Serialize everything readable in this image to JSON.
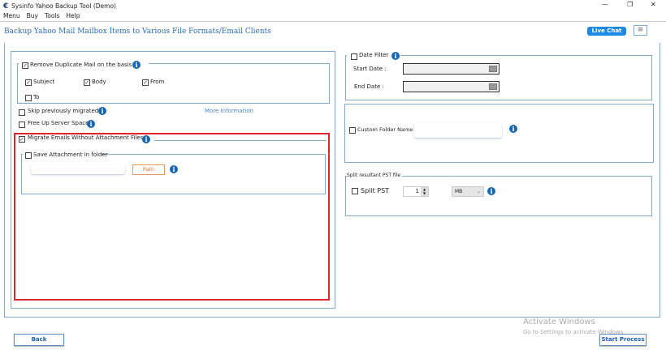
{
  "window": {
    "title": "Sysinfo Yahoo Backup Tool (Demo)",
    "minimize": "—",
    "restore": "❐",
    "close": "✕"
  },
  "menu": [
    "Menu",
    "Buy",
    "Tools",
    "Help"
  ],
  "header": {
    "title": "Backup Yahoo Mail Mailbox Items to Various File Formats/Email Clients",
    "live_chat": "Live Chat",
    "hamburger": "≡"
  },
  "left": {
    "remove_duplicate": {
      "label": "Remove Duplicate Mail on the basis",
      "checked": true,
      "options": [
        {
          "label": "Subject",
          "checked": true
        },
        {
          "label": "Body",
          "checked": true
        },
        {
          "label": "From",
          "checked": true
        },
        {
          "label": "To",
          "checked": false
        }
      ]
    },
    "skip_migrated": {
      "label": "Skip previously migrated",
      "checked": false
    },
    "more_info": "More Information",
    "free_up": {
      "label": "Free Up Server Space",
      "checked": false
    },
    "migrate_without_attachments": {
      "label": "Migrate Emails Without Attachment Files",
      "checked": true
    },
    "save_attachment": {
      "label": "Save Attachment in folder",
      "checked": false,
      "path_value": "",
      "path_button": "Path"
    }
  },
  "right": {
    "date_filter": {
      "label": "Date Filter",
      "checked": false,
      "start_label": "Start Date :",
      "end_label": "End Date :",
      "start_value": "",
      "end_value": ""
    },
    "custom_folder": {
      "label": "Custom Folder Name",
      "checked": false,
      "value": ""
    },
    "split": {
      "group_label": "Split resultant PST file",
      "label": "Split PST",
      "checked": false,
      "size": "1",
      "unit": "MB"
    }
  },
  "footer": {
    "back": "Back",
    "start": "Start Process"
  },
  "watermark": {
    "line1": "Activate Windows",
    "line2": "Go to Settings to activate Windows."
  },
  "check_mark": "✓",
  "info_glyph": "i"
}
